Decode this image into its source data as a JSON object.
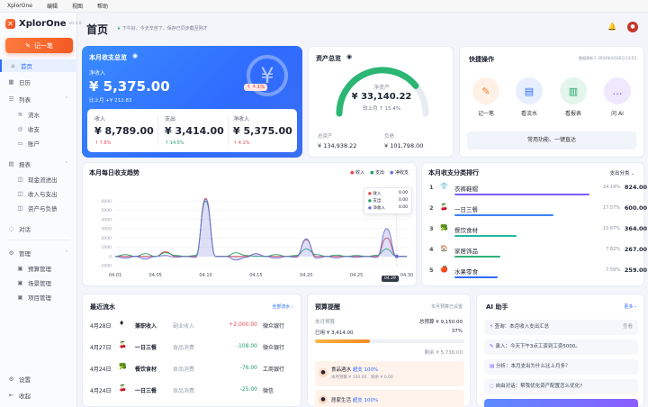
{
  "menubar": [
    "XplorOne",
    "编辑",
    "视图",
    "帮助"
  ],
  "app": {
    "name": "XplorOne",
    "version": "v0.4.0"
  },
  "sidebar": {
    "record_label": "记一笔",
    "items": [
      {
        "icon": "home-icon",
        "glyph": "⌂",
        "label": "首页"
      },
      {
        "icon": "calendar-icon",
        "glyph": "▦",
        "label": "日历"
      },
      {
        "icon": "list-icon",
        "glyph": "☰",
        "label": "列表"
      },
      {
        "icon": "flow-icon",
        "glyph": "≋",
        "label": "流水"
      },
      {
        "icon": "income-icon",
        "glyph": "◎",
        "label": "收支"
      },
      {
        "icon": "account-icon",
        "glyph": "▭",
        "label": "账户"
      },
      {
        "icon": "report-icon",
        "glyph": "▤",
        "label": "报表"
      },
      {
        "icon": "cashflow-icon",
        "glyph": "◫",
        "label": "现金流进出"
      },
      {
        "icon": "income-expense-icon",
        "glyph": "◫",
        "label": "收入与支出"
      },
      {
        "icon": "balance-icon",
        "glyph": "◫",
        "label": "资产与负债"
      },
      {
        "icon": "chat-icon",
        "glyph": "◌",
        "label": "对话"
      },
      {
        "icon": "manage-icon",
        "glyph": "⚙",
        "label": "管理"
      },
      {
        "icon": "budget-manage-icon",
        "glyph": "▣",
        "label": "预算管理"
      },
      {
        "icon": "scene-manage-icon",
        "glyph": "▣",
        "label": "场景管理"
      },
      {
        "icon": "project-manage-icon",
        "glyph": "▣",
        "label": "项目管理"
      }
    ],
    "settings_label": "设置",
    "collapse_label": "收起"
  },
  "header": {
    "title": "首页",
    "subtitle": "下午好，今天辛苦了，保存已同步截至刚才"
  },
  "summary": {
    "title": "本月收支总览",
    "net_label": "净收入",
    "net_value": "¥ 5,375.00",
    "net_badge": "↑ 4.1%",
    "compare": "比上月 +¥ 212.83",
    "currency_glyph": "¥",
    "income_label": "收入",
    "income_value": "¥ 8,789.00",
    "income_change": "↑ 7.8%",
    "expense_label": "支出",
    "expense_value": "¥ 3,414.00",
    "expense_change": "↑ 14.5%",
    "net2_label": "净收入",
    "net2_value": "¥ 5,375.00",
    "net2_change": "↑ 4.1%"
  },
  "assets": {
    "title": "资产总览",
    "net_label": "净资产",
    "net_value": "¥ 33,140.22",
    "compare": "较上月 ↑ 15.4%",
    "total_label": "总资产",
    "total_value": "¥ 134,938.22",
    "debt_label": "负债",
    "debt_value": "¥ 101,798.00",
    "ratio": 0.78
  },
  "quick": {
    "title": "快捷操作",
    "hint": "数据更新于 2024年4月28日 13:53",
    "actions": [
      {
        "label": "记一笔",
        "glyph": "✎",
        "bg": "#fff1e6",
        "fg": "#f07a2e"
      },
      {
        "label": "看流水",
        "glyph": "▤",
        "bg": "#e7efff",
        "fg": "#2f6bff"
      },
      {
        "label": "看报表",
        "glyph": "▥",
        "bg": "#e4f6ec",
        "fg": "#1fa463"
      },
      {
        "label": "问 AI",
        "glyph": "…",
        "bg": "#efe8ff",
        "fg": "#7b4dff"
      }
    ],
    "bar_label": "常用功能、一键直达"
  },
  "trend": {
    "title": "本月每日收支趋势",
    "legend": [
      {
        "name": "收入",
        "color": "#e5484d"
      },
      {
        "name": "支出",
        "color": "#22a06b"
      },
      {
        "name": "净收支",
        "color": "#6a6fd6"
      }
    ],
    "tooltip": {
      "date": "04.29",
      "rows": [
        {
          "name": "收入",
          "value": "0.00"
        },
        {
          "name": "支出",
          "value": "0.00"
        },
        {
          "name": "净收入",
          "value": "0.00"
        }
      ]
    }
  },
  "chart_data": {
    "type": "line",
    "title": "本月每日收支趋势",
    "x": [
      "04.01",
      "04.02",
      "04.03",
      "04.04",
      "04.05",
      "04.06",
      "04.07",
      "04.08",
      "04.09",
      "04.10",
      "04.11",
      "04.12",
      "04.13",
      "04.14",
      "04.15",
      "04.16",
      "04.17",
      "04.18",
      "04.19",
      "04.20",
      "04.21",
      "04.22",
      "04.23",
      "04.24",
      "04.25",
      "04.26",
      "04.27",
      "04.28",
      "04.29",
      "04.30"
    ],
    "tick_labels": [
      "04.01",
      "04.05",
      "04.10",
      "04.15",
      "04.20",
      "04.25",
      "04.30"
    ],
    "ylim": [
      -1000,
      7000
    ],
    "y_ticks": [
      6000,
      5000,
      4000,
      3000,
      2000,
      1000,
      0,
      -1000
    ],
    "series": [
      {
        "name": "收入",
        "values": [
          0,
          0,
          0,
          0,
          0,
          500,
          0,
          0,
          0,
          6300,
          0,
          0,
          0,
          0,
          300,
          0,
          0,
          0,
          0,
          1800,
          0,
          0,
          0,
          0,
          0,
          0,
          0,
          2000,
          0,
          0
        ]
      },
      {
        "name": "支出",
        "values": [
          0,
          200,
          0,
          300,
          0,
          400,
          100,
          0,
          100,
          6000,
          0,
          0,
          400,
          100,
          0,
          0,
          200,
          0,
          100,
          800,
          200,
          0,
          150,
          0,
          100,
          0,
          120,
          800,
          0,
          0
        ]
      },
      {
        "name": "净收支",
        "values": [
          0,
          -200,
          0,
          -300,
          0,
          100,
          -100,
          0,
          -100,
          6200,
          0,
          0,
          -400,
          -100,
          300,
          0,
          -200,
          0,
          -100,
          1900,
          -200,
          0,
          -150,
          0,
          -100,
          0,
          -120,
          3000,
          0,
          0
        ]
      }
    ]
  },
  "rank": {
    "title": "本月收支分类排行",
    "filter": "支出分类",
    "rows": [
      {
        "rank": "1",
        "glyph": "👕",
        "name": "衣裤鞋帽",
        "pct": "24.14%",
        "value": "824.00",
        "fill": 1.0,
        "color": "#7b5cff"
      },
      {
        "rank": "2",
        "glyph": "🍒",
        "name": "一日三餐",
        "pct": "17.57%",
        "value": "600.00",
        "fill": 0.73,
        "color": "#3b82f6"
      },
      {
        "rank": "3",
        "glyph": "🥦",
        "name": "餐饮食材",
        "pct": "10.67%",
        "value": "364.00",
        "fill": 0.46,
        "color": "#22b8a6"
      },
      {
        "rank": "4",
        "glyph": "🏠",
        "name": "家居饰品",
        "pct": "7.82%",
        "value": "267.00",
        "fill": 0.34,
        "color": "#2fb37a"
      },
      {
        "rank": "5",
        "glyph": "🍎",
        "name": "水果零食",
        "pct": "7.59%",
        "value": "259.00",
        "fill": 0.32,
        "color": "#2f6bff"
      }
    ]
  },
  "flow": {
    "title": "最近流水",
    "more": "全部流水 ›",
    "rows": [
      {
        "date": "4月28日",
        "glyph": "♦",
        "name": "兼职收入",
        "cat": "副业收入",
        "amount": "+2,000.00",
        "account": "微众银行",
        "income": true
      },
      {
        "date": "4月27日",
        "glyph": "🍒",
        "name": "一日三餐",
        "cat": "食品消费",
        "amount": "-108.00",
        "account": "微众银行",
        "income": false
      },
      {
        "date": "4月24日",
        "glyph": "🥦",
        "name": "餐饮食材",
        "cat": "食品消费",
        "amount": "-76.00",
        "account": "工商银行",
        "income": false
      },
      {
        "date": "4月24日",
        "glyph": "🍒",
        "name": "一日三餐",
        "cat": "食品消费",
        "amount": "-25.00",
        "account": "微信",
        "income": false
      }
    ]
  },
  "budget": {
    "title": "预算提醒",
    "more": "本月预算已设置",
    "used_label": "本月预算",
    "used_total": "总预算 ¥ 9,150.00",
    "spent": "已用 ¥ 3,414.00",
    "pct": "37%",
    "ratio": 0.37,
    "remain": "剩余 ¥ 5,736.00",
    "items": [
      {
        "name": "食品酒水",
        "tag": "超支 100%",
        "detail": "本月预算 ¥ 100.00　剩余 ¥ 0.00"
      },
      {
        "name": "居家生活",
        "tag": "超支 100%",
        "detail": ""
      }
    ]
  },
  "ai": {
    "title": "AI 助手",
    "more": "更多 ›",
    "items": [
      {
        "text": "查询：本月收入支出汇总",
        "tag": "查看"
      },
      {
        "text": "录入：今天下午3点工资到工资5000。",
        "tag": ""
      },
      {
        "text": "分析：本月支出为什么比上月多？",
        "tag": ""
      },
      {
        "text": "自由对话：帮我优化资产配置怎么优化?",
        "tag": ""
      }
    ]
  }
}
